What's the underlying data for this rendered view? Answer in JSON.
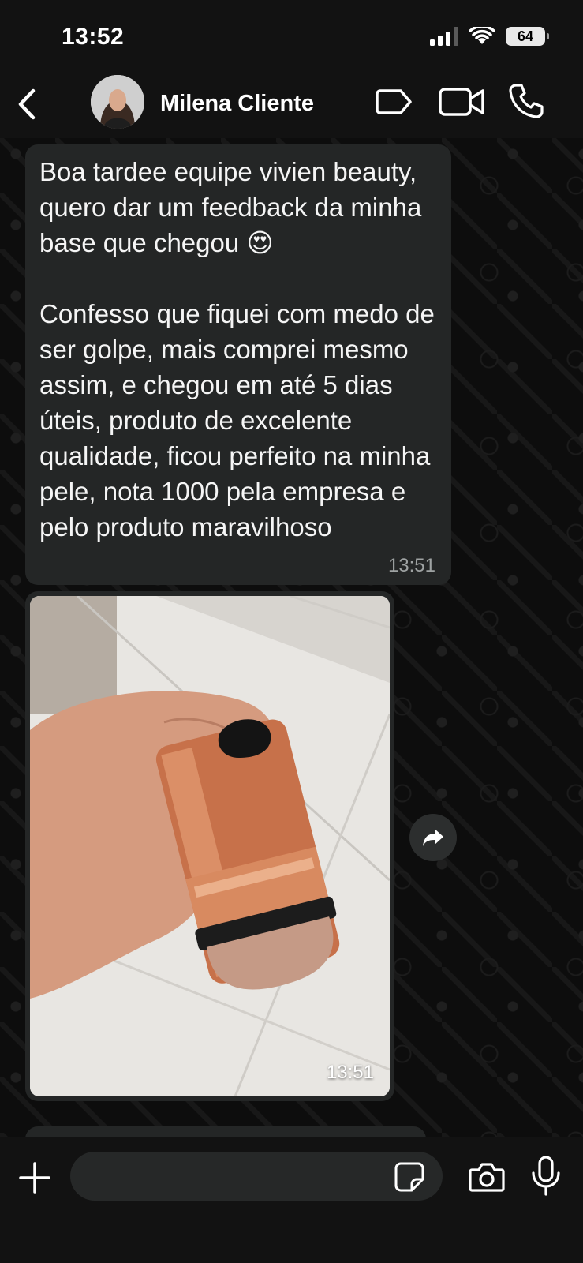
{
  "status_bar": {
    "time": "13:52",
    "battery": "64"
  },
  "header": {
    "contact_name": "Milena Cliente"
  },
  "messages": [
    {
      "text": "Boa tardee equipe vivien beauty, quero dar um feedback da minha base que chegou 😍\n\nConfesso que fiquei com medo de ser golpe, mais comprei mesmo assim, e chegou em até 5 dias úteis, produto de excelente qualidade, ficou perfeito na minha pele, nota 1000 pela empresa e pelo produto maravilhoso",
      "time": "13:51"
    },
    {
      "type": "image",
      "time": "13:51"
    }
  ],
  "input": {
    "placeholder": ""
  },
  "colors": {
    "bubble": "#242626",
    "background": "#0b0b0b",
    "bar": "#121212"
  },
  "icons": [
    "back-icon",
    "label-icon",
    "video-call-icon",
    "phone-icon",
    "forward-icon",
    "plus-icon",
    "sticker-icon",
    "camera-icon",
    "microphone-icon"
  ]
}
